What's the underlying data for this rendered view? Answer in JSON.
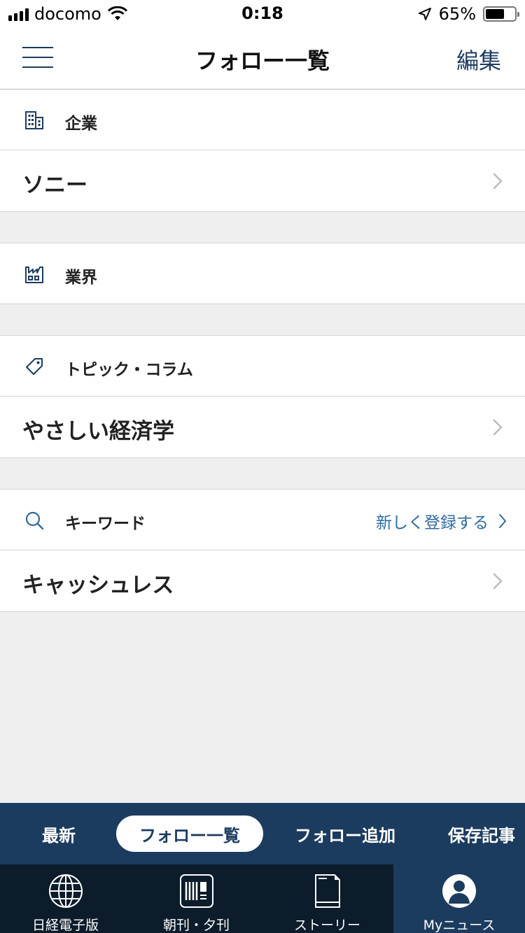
{
  "status_bar": {
    "carrier": "docomo",
    "time": "0:18",
    "battery_percent": "65%",
    "battery_level": 0.65
  },
  "navbar": {
    "title": "フォロー一覧",
    "edit_label": "編集"
  },
  "sections": {
    "company": {
      "label": "企業",
      "icon": "building-icon",
      "items": [
        "ソニー"
      ]
    },
    "industry": {
      "label": "業界",
      "icon": "factory-icon"
    },
    "topic": {
      "label": "トピック・コラム",
      "icon": "tag-icon",
      "items": [
        "やさしい経済学"
      ]
    },
    "keyword": {
      "label": "キーワード",
      "icon": "search-icon",
      "register_label": "新しく登録する",
      "items": [
        "キャッシュレス"
      ]
    }
  },
  "sub_tabs": [
    "最新",
    "フォロー一覧",
    "フォロー追加",
    "保存記事"
  ],
  "active_sub_tab": "フォロー一覧",
  "main_tabs": [
    {
      "label": "日経電子版",
      "icon": "globe-icon"
    },
    {
      "label": "朝刊・夕刊",
      "icon": "newspaper-icon"
    },
    {
      "label": "ストーリー",
      "icon": "book-icon"
    },
    {
      "label": "Myニュース",
      "icon": "person-icon"
    }
  ],
  "active_main_tab": "Myニュース",
  "colors": {
    "navy": "#1c3c5f",
    "dark_navy": "#0c1c2b",
    "link_blue": "#2e6aa0",
    "background": "#efefef"
  }
}
